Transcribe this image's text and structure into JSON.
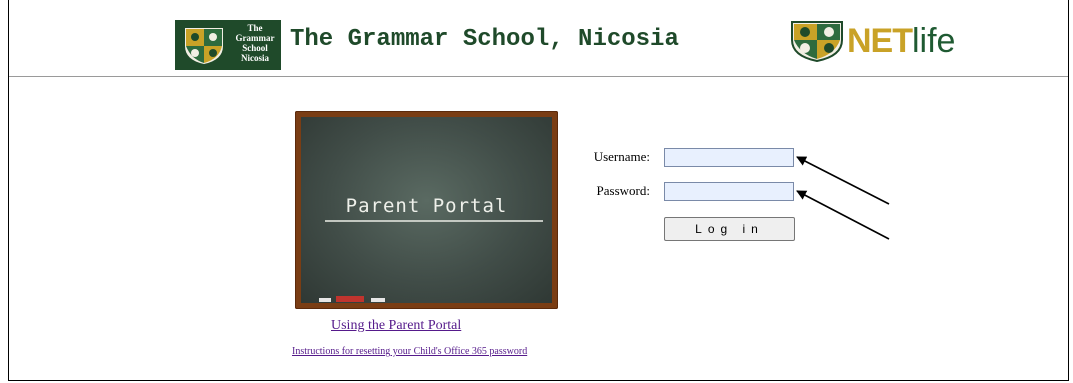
{
  "header": {
    "logo_text_lines": [
      "The",
      "Grammar",
      "School",
      "Nicosia"
    ],
    "site_title": "The Grammar School, Nicosia",
    "brand_net": "NET",
    "brand_life": "life"
  },
  "board": {
    "title": "Parent Portal"
  },
  "links": {
    "using_portal": "Using the Parent Portal",
    "reset_password": "Instructions for resetting your Child's Office 365 password"
  },
  "login": {
    "username_label": "Username:",
    "password_label": "Password:",
    "username_value": "",
    "password_value": "",
    "button_label": "Log in"
  },
  "colors": {
    "brand_green": "#1f4a2a",
    "brand_gold": "#c9a227",
    "field_bg": "#e8f0fe",
    "link": "#551a8b"
  }
}
